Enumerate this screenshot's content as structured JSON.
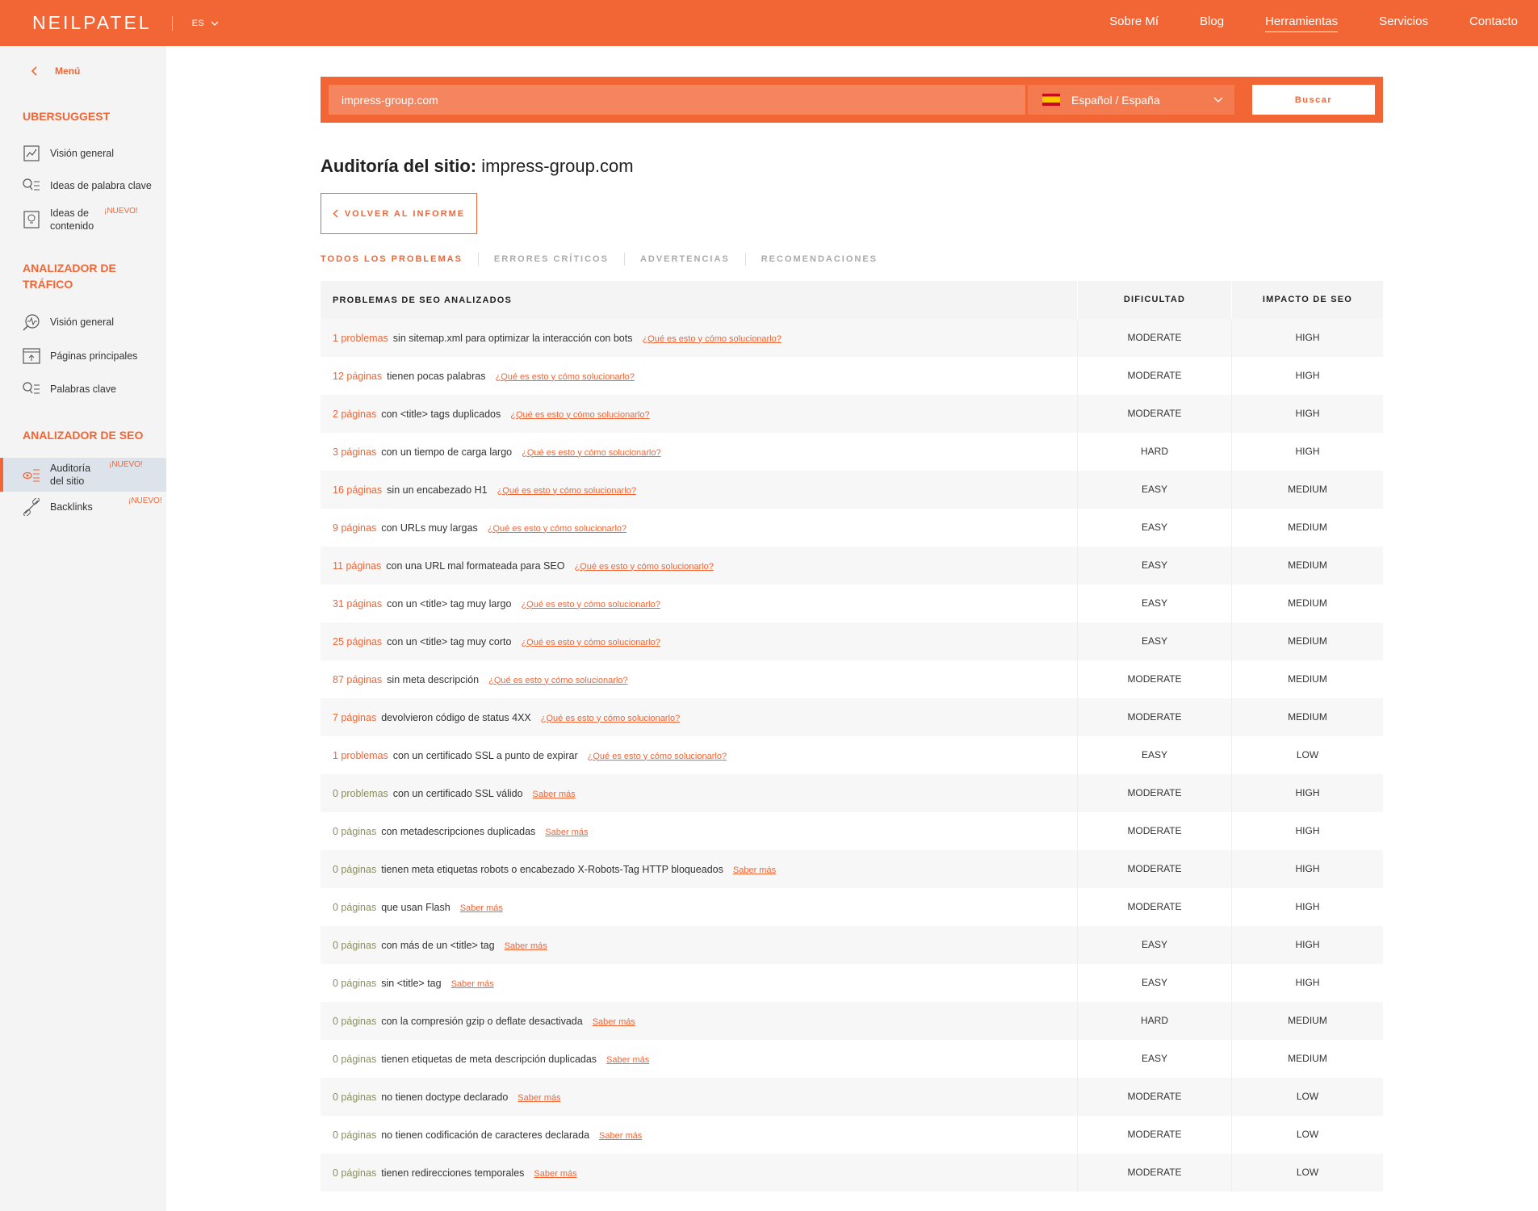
{
  "header": {
    "logo": "NEILPATEL",
    "lang": "ES",
    "nav": [
      "Sobre Mí",
      "Blog",
      "Herramientas",
      "Servicios",
      "Contacto"
    ],
    "active_nav": "Herramientas"
  },
  "sidebar": {
    "menu_label": "Menú",
    "sections": [
      {
        "title": "UBERSUGGEST"
      },
      {
        "title": "ANALIZADOR DE TRÁFICO"
      },
      {
        "title": "ANALIZADOR DE SEO"
      }
    ],
    "items": {
      "ub_overview": "Visión general",
      "ub_keywords": "Ideas de palabra clave",
      "ub_content_1": "Ideas de",
      "ub_content_2": "contenido",
      "tr_overview": "Visión general",
      "tr_pages": "Páginas principales",
      "tr_keywords": "Palabras clave",
      "seo_audit_1": "Auditoría",
      "seo_audit_2": "del sitio",
      "seo_backlinks": "Backlinks"
    },
    "badge": "¡NUEVO!"
  },
  "search": {
    "value": "impress-group.com",
    "language": "Español / España",
    "button": "Buscar"
  },
  "page": {
    "title_bold": "Auditoría del sitio:",
    "title_domain": "impress-group.com",
    "back_button": "VOLVER AL INFORME"
  },
  "tabs": [
    "TODOS LOS PROBLEMAS",
    "ERRORES CRÍTICOS",
    "ADVERTENCIAS",
    "RECOMENDACIONES"
  ],
  "table": {
    "headers": [
      "PROBLEMAS DE SEO ANALIZADOS",
      "DIFICULTAD",
      "IMPACTO DE SEO"
    ],
    "rows": [
      {
        "count": "1 problemas",
        "text": "sin sitemap.xml para optimizar la interacción con bots",
        "link": "¿Qué es esto y cómo solucionarlo?",
        "difficulty": "MODERATE",
        "impact": "HIGH",
        "zero": false
      },
      {
        "count": "12 páginas",
        "text": "tienen pocas palabras",
        "link": "¿Qué es esto y cómo solucionarlo?",
        "difficulty": "MODERATE",
        "impact": "HIGH",
        "zero": false
      },
      {
        "count": "2 páginas",
        "text": "con <title> tags duplicados",
        "link": "¿Qué es esto y cómo solucionarlo?",
        "difficulty": "MODERATE",
        "impact": "HIGH",
        "zero": false
      },
      {
        "count": "3 páginas",
        "text": "con un tiempo de carga largo",
        "link": "¿Qué es esto y cómo solucionarlo?",
        "difficulty": "HARD",
        "impact": "HIGH",
        "zero": false
      },
      {
        "count": "16 páginas",
        "text": "sin un encabezado H1",
        "link": "¿Qué es esto y cómo solucionarlo?",
        "difficulty": "EASY",
        "impact": "MEDIUM",
        "zero": false
      },
      {
        "count": "9 páginas",
        "text": "con URLs muy largas",
        "link": "¿Qué es esto y cómo solucionarlo?",
        "difficulty": "EASY",
        "impact": "MEDIUM",
        "zero": false
      },
      {
        "count": "11 páginas",
        "text": "con una URL mal formateada para SEO",
        "link": "¿Qué es esto y cómo solucionarlo?",
        "difficulty": "EASY",
        "impact": "MEDIUM",
        "zero": false
      },
      {
        "count": "31 páginas",
        "text": "con un <title> tag muy largo",
        "link": "¿Qué es esto y cómo solucionarlo?",
        "difficulty": "EASY",
        "impact": "MEDIUM",
        "zero": false
      },
      {
        "count": "25 páginas",
        "text": "con un <title> tag muy corto",
        "link": "¿Qué es esto y cómo solucionarlo?",
        "difficulty": "EASY",
        "impact": "MEDIUM",
        "zero": false
      },
      {
        "count": "87 páginas",
        "text": "sin meta descripción",
        "link": "¿Qué es esto y cómo solucionarlo?",
        "difficulty": "MODERATE",
        "impact": "MEDIUM",
        "zero": false
      },
      {
        "count": "7 páginas",
        "text": "devolvieron código de status 4XX",
        "link": "¿Qué es esto y cómo solucionarlo?",
        "difficulty": "MODERATE",
        "impact": "MEDIUM",
        "zero": false
      },
      {
        "count": "1 problemas",
        "text": "con un certificado SSL a punto de expirar",
        "link": "¿Qué es esto y cómo solucionarlo?",
        "difficulty": "EASY",
        "impact": "LOW",
        "zero": false
      },
      {
        "count": "0 problemas",
        "text": "con un certificado SSL válido",
        "link": "Saber más",
        "difficulty": "MODERATE",
        "impact": "HIGH",
        "zero": true
      },
      {
        "count": "0 páginas",
        "text": "con metadescripciones duplicadas",
        "link": "Saber más",
        "difficulty": "MODERATE",
        "impact": "HIGH",
        "zero": true
      },
      {
        "count": "0 páginas",
        "text": "tienen meta etiquetas robots o encabezado X-Robots-Tag HTTP bloqueados",
        "link": "Saber más",
        "difficulty": "MODERATE",
        "impact": "HIGH",
        "zero": true
      },
      {
        "count": "0 páginas",
        "text": "que usan Flash",
        "link": "Saber más",
        "difficulty": "MODERATE",
        "impact": "HIGH",
        "zero": true
      },
      {
        "count": "0 páginas",
        "text": "con más de un <title> tag",
        "link": "Saber más",
        "difficulty": "EASY",
        "impact": "HIGH",
        "zero": true
      },
      {
        "count": "0 páginas",
        "text": "sin <title> tag",
        "link": "Saber más",
        "difficulty": "EASY",
        "impact": "HIGH",
        "zero": true
      },
      {
        "count": "0 páginas",
        "text": "con la compresión gzip o deflate desactivada",
        "link": "Saber más",
        "difficulty": "HARD",
        "impact": "MEDIUM",
        "zero": true
      },
      {
        "count": "0 páginas",
        "text": "tienen etiquetas de meta descripción duplicadas",
        "link": "Saber más",
        "difficulty": "EASY",
        "impact": "MEDIUM",
        "zero": true
      },
      {
        "count": "0 páginas",
        "text": "no tienen doctype declarado",
        "link": "Saber más",
        "difficulty": "MODERATE",
        "impact": "LOW",
        "zero": true
      },
      {
        "count": "0 páginas",
        "text": "no tienen codificación de caracteres declarada",
        "link": "Saber más",
        "difficulty": "MODERATE",
        "impact": "LOW",
        "zero": true
      },
      {
        "count": "0 páginas",
        "text": "tienen redirecciones temporales",
        "link": "Saber más",
        "difficulty": "MODERATE",
        "impact": "LOW",
        "zero": true
      }
    ]
  },
  "colors": {
    "brand": "#f26535",
    "sidebar_bg": "#f4f4f4",
    "zero_count": "#8a8f5c"
  }
}
